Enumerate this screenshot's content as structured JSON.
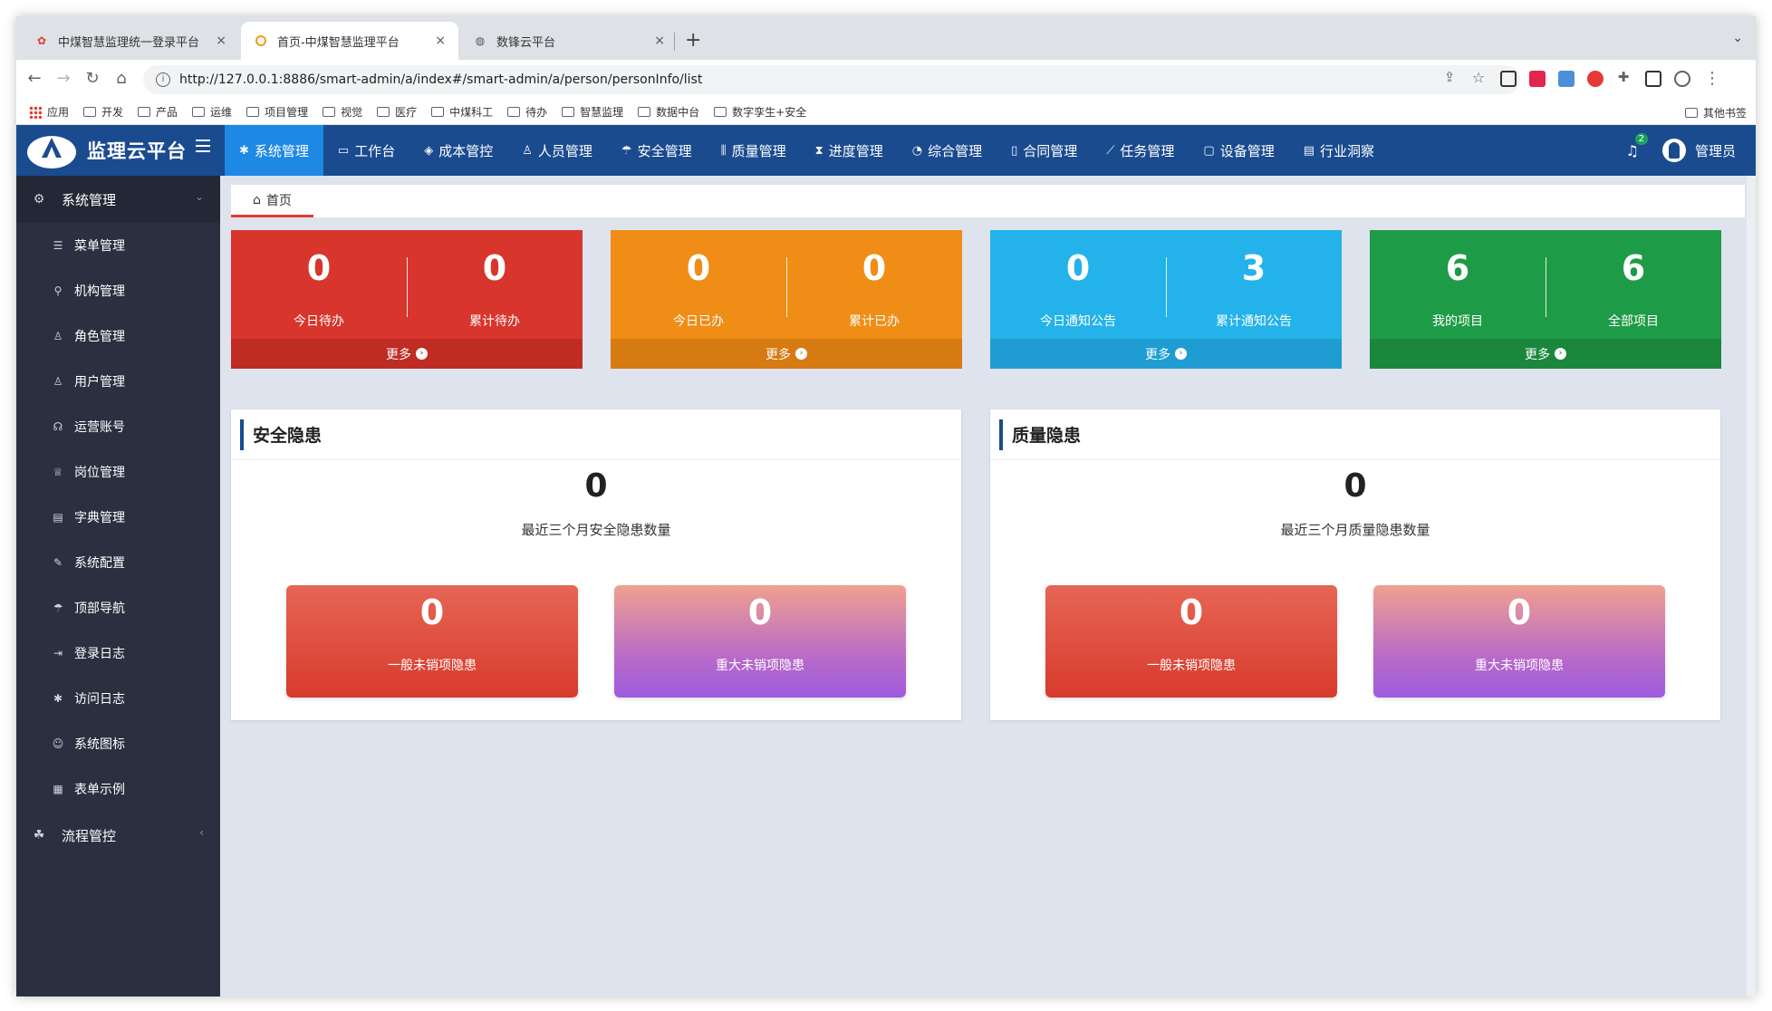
{
  "browser": {
    "tabs": [
      {
        "label": "中煤智慧监理统一登录平台",
        "icon": "app-favicon-icon"
      },
      {
        "label": "首页-中煤智慧监理平台",
        "icon": "orange-favicon-icon"
      },
      {
        "label": "数锋云平台",
        "icon": "globe-icon"
      }
    ],
    "tab_close": "×",
    "new_tab": "+",
    "url": "http://127.0.0.1:8886/smart-admin/a/index#/smart-admin/a/person/personInfo/list",
    "bookmarks": [
      "应用",
      "开发",
      "产品",
      "运维",
      "项目管理",
      "视觉",
      "医疗",
      "中煤科工",
      "待办",
      "智慧监理",
      "数据中台",
      "数字孪生+安全"
    ],
    "other_bookmarks": "其他书签"
  },
  "header": {
    "title": "监理云平台",
    "nav": [
      {
        "label": "系统管理",
        "icon": "✱"
      },
      {
        "label": "工作台",
        "icon": "▭"
      },
      {
        "label": "成本管控",
        "icon": "◈"
      },
      {
        "label": "人员管理",
        "icon": "♙"
      },
      {
        "label": "安全管理",
        "icon": "☂"
      },
      {
        "label": "质量管理",
        "icon": "⫼"
      },
      {
        "label": "进度管理",
        "icon": "⧗"
      },
      {
        "label": "综合管理",
        "icon": "◔"
      },
      {
        "label": "合同管理",
        "icon": "▯"
      },
      {
        "label": "任务管理",
        "icon": "⟋"
      },
      {
        "label": "设备管理",
        "icon": "▢"
      },
      {
        "label": "行业洞察",
        "icon": "▤"
      }
    ],
    "notification_count": "2",
    "user": "管理员"
  },
  "sidebar": {
    "group1": "系统管理",
    "items": [
      {
        "label": "菜单管理",
        "icon": "☰"
      },
      {
        "label": "机构管理",
        "icon": "⚲"
      },
      {
        "label": "角色管理",
        "icon": "♙"
      },
      {
        "label": "用户管理",
        "icon": "♙"
      },
      {
        "label": "运营账号",
        "icon": "☊"
      },
      {
        "label": "岗位管理",
        "icon": "♕"
      },
      {
        "label": "字典管理",
        "icon": "▤"
      },
      {
        "label": "系统配置",
        "icon": "✎"
      },
      {
        "label": "顶部导航",
        "icon": "☂"
      },
      {
        "label": "登录日志",
        "icon": "⇥"
      },
      {
        "label": "访问日志",
        "icon": "✱"
      },
      {
        "label": "系统图标",
        "icon": "☺"
      },
      {
        "label": "表单示例",
        "icon": "▦"
      }
    ],
    "group2": "流程管控",
    "group2_chevron": "‹",
    "group1_chevron": "⌄"
  },
  "breadcrumb": {
    "home": "首页"
  },
  "stats": [
    {
      "left_num": "0",
      "left_label": "今日待办",
      "right_num": "0",
      "right_label": "累计待办",
      "more": "更多",
      "color": "#d8352c",
      "more_color": "#bf2c24"
    },
    {
      "left_num": "0",
      "left_label": "今日已办",
      "right_num": "0",
      "right_label": "累计已办",
      "more": "更多",
      "color": "#ef8d16",
      "more_color": "#d67a12"
    },
    {
      "left_num": "0",
      "left_label": "今日通知公告",
      "right_num": "3",
      "right_label": "累计通知公告",
      "more": "更多",
      "color": "#23b3ea",
      "more_color": "#1f9dd3"
    },
    {
      "left_num": "6",
      "left_label": "我的项目",
      "right_num": "6",
      "right_label": "全部项目",
      "more": "更多",
      "color": "#1e9b46",
      "more_color": "#1b873d"
    }
  ],
  "panels": [
    {
      "title": "安全隐患",
      "total": "0",
      "subtitle": "最近三个月安全隐患数量",
      "general_num": "0",
      "general_label": "一般未销项隐患",
      "major_num": "0",
      "major_label": "重大未销项隐患"
    },
    {
      "title": "质量隐患",
      "total": "0",
      "subtitle": "最近三个月质量隐患数量",
      "general_num": "0",
      "general_label": "一般未销项隐患",
      "major_num": "0",
      "major_label": "重大未销项隐患"
    }
  ]
}
